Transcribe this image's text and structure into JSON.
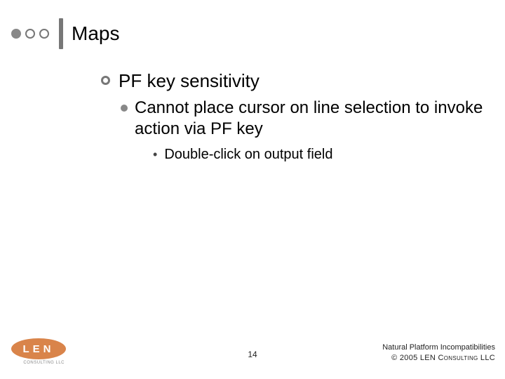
{
  "header": {
    "title": "Maps"
  },
  "body": {
    "l1": "PF key sensitivity",
    "l2": "Cannot place cursor on line selection to invoke action via PF key",
    "l3": "Double-click on output field"
  },
  "footer": {
    "logo_letters": "LEN",
    "logo_sub": "CONSULTING LLC",
    "page_number": "14",
    "copy_line1": "Natural Platform Incompatibilities",
    "copy_line2": "© 2005 LEN Consulting LLC"
  }
}
